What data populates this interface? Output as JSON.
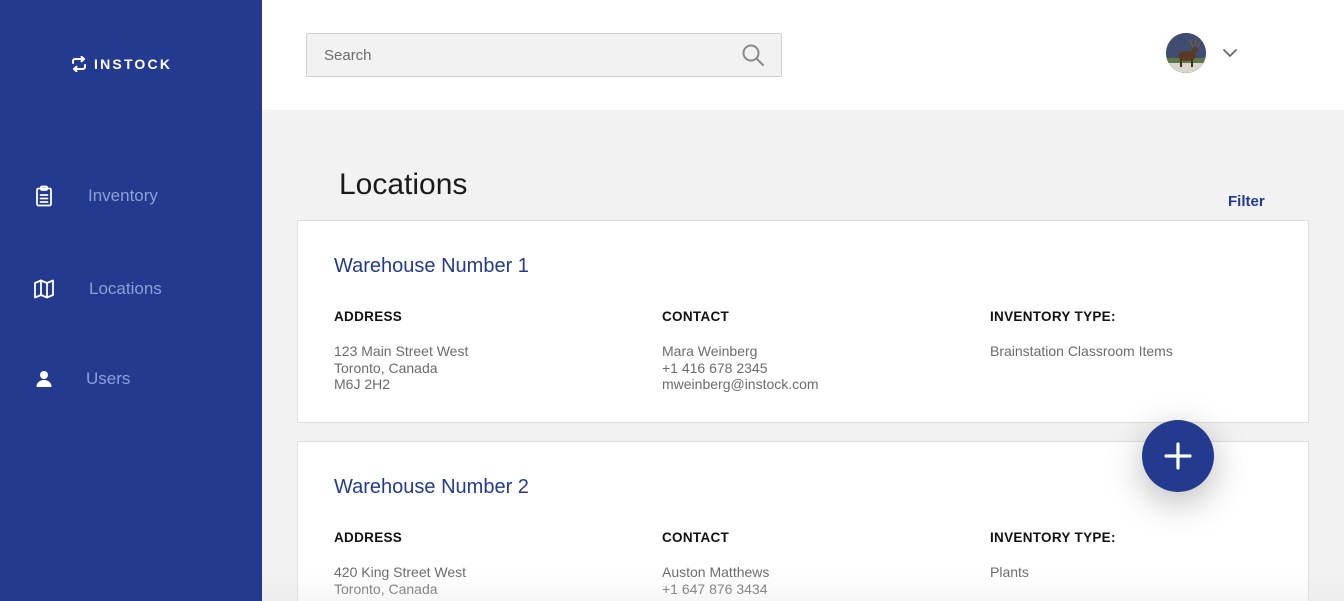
{
  "brand": {
    "name": "INSTOCK",
    "logo_icon": "refresh-arrows-icon"
  },
  "sidebar": {
    "items": [
      {
        "label": "Inventory",
        "icon": "clipboard-icon"
      },
      {
        "label": "Locations",
        "icon": "map-icon"
      },
      {
        "label": "Users",
        "icon": "user-icon"
      }
    ]
  },
  "topbar": {
    "search": {
      "placeholder": "Search",
      "value": "",
      "icon": "search-icon"
    },
    "avatar": {
      "icon": "avatar"
    },
    "menu_icon": "chevron-down-icon"
  },
  "page": {
    "title": "Locations",
    "filter_label": "Filter"
  },
  "locations": [
    {
      "name": "Warehouse Number 1",
      "address_label": "ADDRESS",
      "address": [
        "123 Main Street West",
        "Toronto, Canada",
        "M6J 2H2"
      ],
      "contact_label": "CONTACT",
      "contact": [
        "Mara Weinberg",
        "+1 416 678 2345",
        "mweinberg@instock.com"
      ],
      "inventory_label": "INVENTORY TYPE:",
      "inventory": [
        "Brainstation Classroom Items"
      ]
    },
    {
      "name": "Warehouse Number 2",
      "address_label": "ADDRESS",
      "address": [
        "420 King Street West",
        "Toronto, Canada"
      ],
      "contact_label": "CONTACT",
      "contact": [
        "Auston Matthews",
        "+1 647 876 3434"
      ],
      "inventory_label": "INVENTORY TYPE:",
      "inventory": [
        "Plants"
      ]
    }
  ],
  "fab": {
    "icon": "plus-icon"
  },
  "colors": {
    "primary": "#233a8f",
    "nav_text": "#8aa0d8",
    "background": "#f2f2f2",
    "card": "#ffffff"
  }
}
